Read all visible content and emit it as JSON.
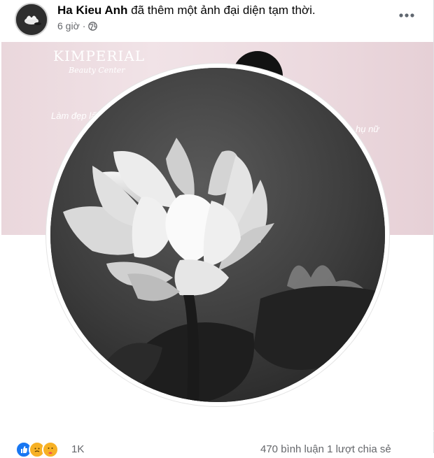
{
  "post": {
    "author": "Ha Kieu Anh",
    "action": "đã thêm một ảnh đại diện tạm thời.",
    "time": "6 giờ",
    "separator": "·",
    "privacy_icon": "globe-icon",
    "more_icon": "more-options-icon"
  },
  "cover": {
    "brand": "KIMPERIAL",
    "brand_sub": "Beauty Center",
    "tagline_left": "Làm đẹp lấ",
    "tagline_right": "hụ nữ"
  },
  "footer": {
    "reactions": [
      "like-icon",
      "sad-icon",
      "care-icon"
    ],
    "reaction_count": "1K",
    "comments_shares": "470 bình luận  1 lượt chia sẻ"
  },
  "colors": {
    "accent_like": "#1877f2",
    "secondary_text": "#65676b",
    "cover_pink": "#ecdadf"
  }
}
